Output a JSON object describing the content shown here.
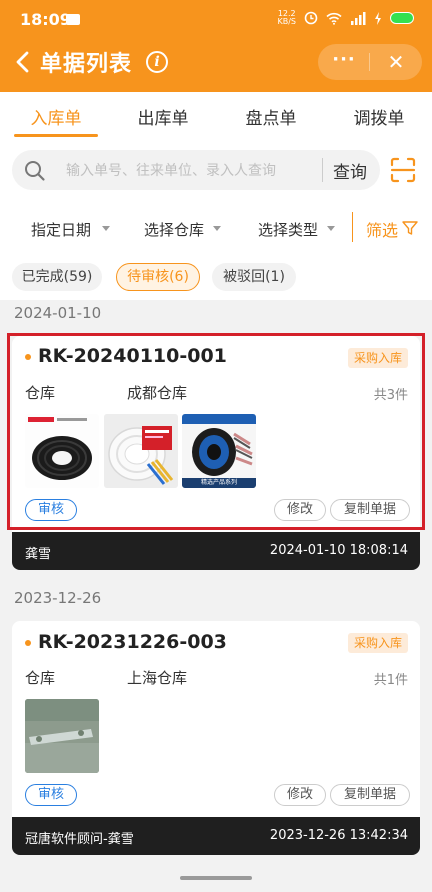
{
  "status_bar": {
    "time": "18:09",
    "net_speed_top": "12.2",
    "net_speed_bottom": "KB/S"
  },
  "header": {
    "title": "单据列表",
    "info_glyph": "i",
    "more_glyph": "···",
    "close_glyph": "✕"
  },
  "tabs": [
    {
      "label": "入库单",
      "active": true
    },
    {
      "label": "出库单",
      "active": false
    },
    {
      "label": "盘点单",
      "active": false
    },
    {
      "label": "调拨单",
      "active": false
    }
  ],
  "search": {
    "placeholder": "输入单号、往来单位、录入人查询",
    "button": "查询"
  },
  "filters": {
    "date": "指定日期",
    "warehouse": "选择仓库",
    "type": "选择类型",
    "filter_button": "筛选"
  },
  "status_chips": [
    {
      "label": "已完成(59)",
      "active": false
    },
    {
      "label": "待审核(6)",
      "active": true
    },
    {
      "label": "被驳回(1)",
      "active": false
    }
  ],
  "groups": [
    {
      "date": "2024-01-10",
      "card": {
        "order_no": "RK-20240110-001",
        "type_badge": "采购入库",
        "warehouse_label": "仓库",
        "warehouse": "成都仓库",
        "item_count": "共3件",
        "audit_button": "审核",
        "edit_button": "修改",
        "copy_button": "复制单据",
        "creator": "龚雪",
        "created_at": "2024-01-10 18:08:14",
        "thumb_caption": "精选产品系列"
      }
    },
    {
      "date": "2023-12-26",
      "card": {
        "order_no": "RK-20231226-003",
        "type_badge": "采购入库",
        "warehouse_label": "仓库",
        "warehouse": "上海仓库",
        "item_count": "共1件",
        "audit_button": "审核",
        "edit_button": "修改",
        "copy_button": "复制单据",
        "creator": "冠唐软件顾问-龚雪",
        "created_at": "2023-12-26 13:42:34"
      }
    }
  ],
  "colors": {
    "brand": "#f7941d",
    "audit_blue": "#2a7fe0",
    "highlight_red": "#d42029",
    "footer_dark": "#1f1f1f"
  }
}
